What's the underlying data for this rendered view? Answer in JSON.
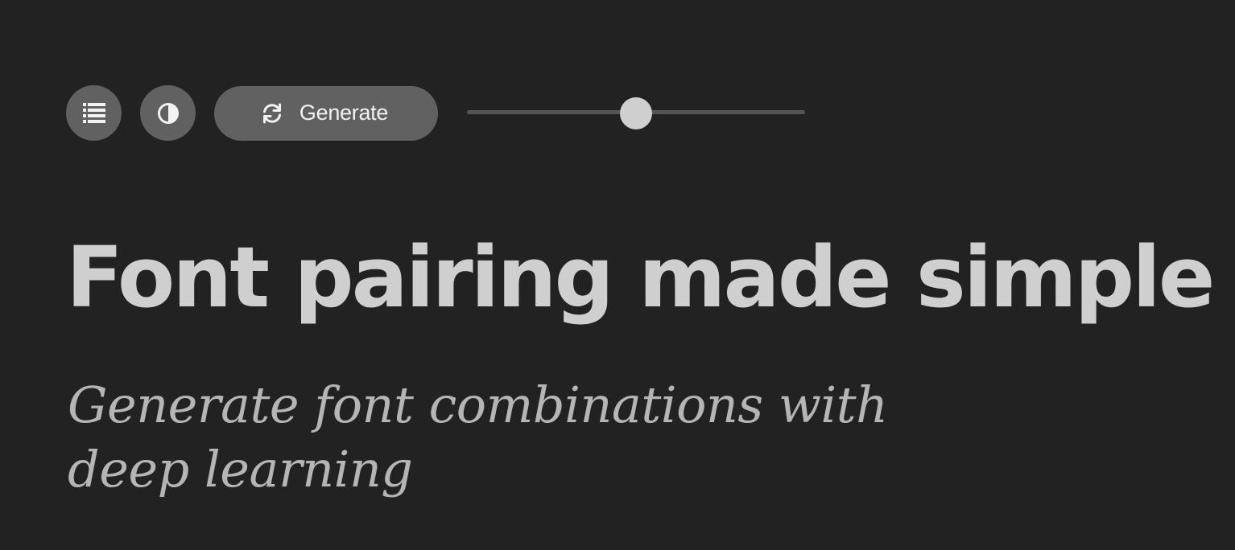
{
  "toolbar": {
    "list_button": {
      "icon": "list-icon"
    },
    "theme_button": {
      "icon": "contrast-icon"
    },
    "generate_button": {
      "icon": "refresh-icon",
      "label": "Generate"
    },
    "slider": {
      "value": 0.5
    }
  },
  "hero": {
    "title": "Font pairing made simple",
    "subtitle": "Generate font combinations with deep learning"
  },
  "colors": {
    "background": "#222222",
    "button": "#616161",
    "title": "#cfcfcf",
    "subtitle": "#b5b5b5",
    "slider_track": "#555555",
    "slider_thumb": "#cfcfcf"
  }
}
